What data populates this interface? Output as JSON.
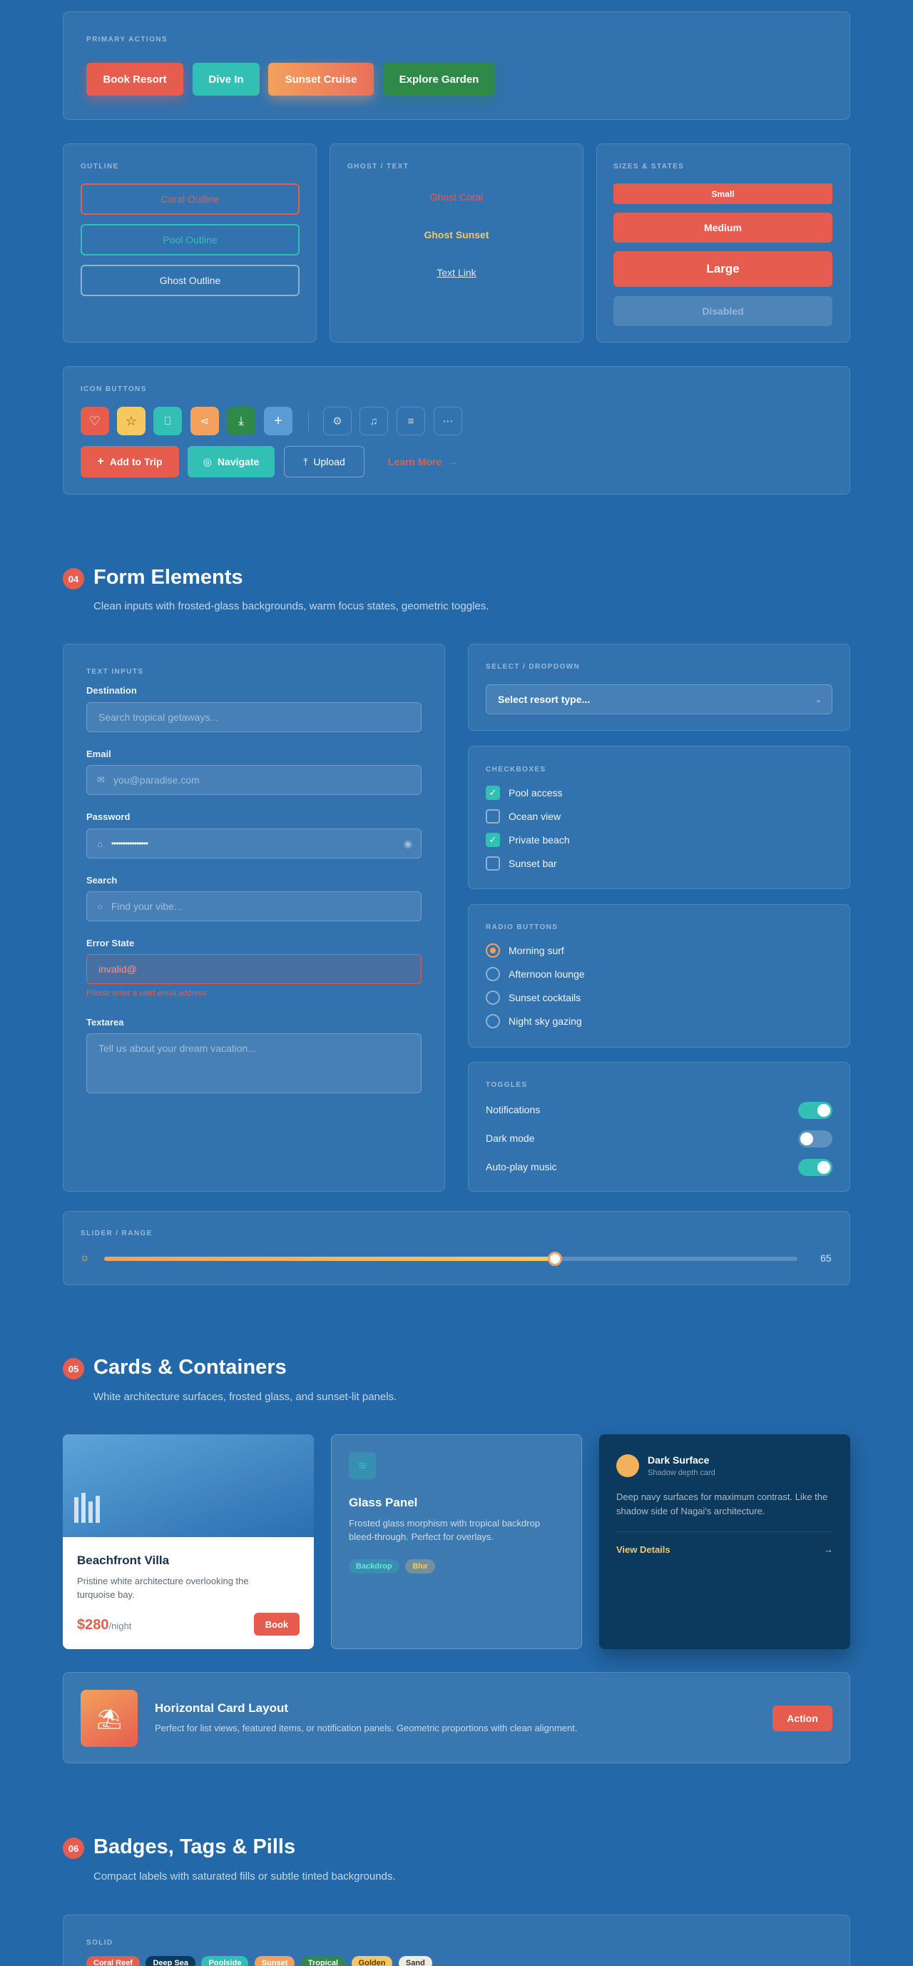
{
  "primary_actions": {
    "label": "PRIMARY ACTIONS",
    "buttons": [
      "Book Resort",
      "Dive In",
      "Sunset Cruise",
      "Explore Garden"
    ]
  },
  "outline": {
    "label": "OUTLINE",
    "buttons": [
      "Coral Outline",
      "Pool Outline",
      "Ghost Outline"
    ]
  },
  "ghost_text": {
    "label": "GHOST / TEXT",
    "buttons": [
      "Ghost Coral",
      "Ghost Sunset",
      "Text Link"
    ]
  },
  "sizes": {
    "label": "SIZES & STATES",
    "buttons": [
      "Small",
      "Medium",
      "Large",
      "Disabled"
    ]
  },
  "icon_buttons": {
    "label": "ICON BUTTONS",
    "colored_icons": [
      "heart-icon",
      "star-icon",
      "bookmark-icon",
      "share-icon",
      "download-icon",
      "plus-icon"
    ],
    "ghost_icons": [
      "gear-icon",
      "bell-icon",
      "menu-icon",
      "more-icon"
    ],
    "actions": [
      "Add to Trip",
      "Navigate",
      "Upload",
      "Learn More"
    ]
  },
  "forms": {
    "number": "04",
    "title": "Form Elements",
    "subtitle": "Clean inputs with frosted-glass backgrounds, warm focus states, geometric toggles.",
    "text_inputs_label": "TEXT INPUTS",
    "destination": {
      "label": "Destination",
      "placeholder": "Search tropical getaways..."
    },
    "email": {
      "label": "Email",
      "placeholder": "you@paradise.com"
    },
    "password": {
      "label": "Password",
      "value": "••••••••••••••••"
    },
    "search": {
      "label": "Search",
      "placeholder": "Find your vibe..."
    },
    "error": {
      "label": "Error State",
      "value": "invalid@",
      "message": "Please enter a valid email address"
    },
    "textarea": {
      "label": "Textarea",
      "placeholder": "Tell us about your dream vacation..."
    },
    "select": {
      "label": "SELECT / DROPDOWN",
      "value": "Select resort type..."
    },
    "checkboxes": {
      "label": "CHECKBOXES",
      "items": [
        {
          "label": "Pool access",
          "checked": true
        },
        {
          "label": "Ocean view",
          "checked": false
        },
        {
          "label": "Private beach",
          "checked": true
        },
        {
          "label": "Sunset bar",
          "checked": false
        }
      ]
    },
    "radios": {
      "label": "RADIO BUTTONS",
      "items": [
        {
          "label": "Morning surf",
          "selected": true
        },
        {
          "label": "Afternoon lounge",
          "selected": false
        },
        {
          "label": "Sunset cocktails",
          "selected": false
        },
        {
          "label": "Night sky gazing",
          "selected": false
        }
      ]
    },
    "toggles": {
      "label": "TOGGLES",
      "items": [
        {
          "label": "Notifications",
          "on": true
        },
        {
          "label": "Dark mode",
          "on": false
        },
        {
          "label": "Auto-play music",
          "on": true
        }
      ]
    },
    "slider": {
      "label": "SLIDER / RANGE",
      "value": "65",
      "fraction": 0.65
    }
  },
  "cards": {
    "number": "05",
    "title": "Cards & Containers",
    "subtitle": "White architecture surfaces, frosted glass, and sunset-lit panels.",
    "villa": {
      "title": "Beachfront Villa",
      "desc": "Pristine white architecture overlooking the turquoise bay.",
      "price": "$280",
      "unit": "/night",
      "button": "Book"
    },
    "glass": {
      "title": "Glass Panel",
      "desc": "Frosted glass morphism with tropical backdrop bleed-through. Perfect for overlays.",
      "tags": [
        "Backdrop",
        "Blur"
      ]
    },
    "dark": {
      "title": "Dark Surface",
      "subtitle": "Shadow depth card",
      "desc": "Deep navy surfaces for maximum contrast. Like the shadow side of Nagai's architecture.",
      "link": "View Details"
    },
    "horizontal": {
      "title": "Horizontal Card Layout",
      "desc": "Perfect for list views, featured items, or notification panels. Geometric proportions with clean alignment.",
      "button": "Action"
    }
  },
  "badges": {
    "number": "06",
    "title": "Badges, Tags & Pills",
    "subtitle": "Compact labels with saturated fills or subtle tinted backgrounds.",
    "solid_label": "SOLID",
    "solid": [
      "Coral Reef",
      "Deep Sea",
      "Poolside",
      "Sunset",
      "Tropical",
      "Golden",
      "Sand"
    ]
  },
  "colors": {
    "coral": "#e65d4f",
    "pool": "#33c0b4",
    "sunset": "#f3a15c",
    "garden": "#2f8a4a",
    "golden": "#f6c85f",
    "navy": "#0c3a5e"
  }
}
